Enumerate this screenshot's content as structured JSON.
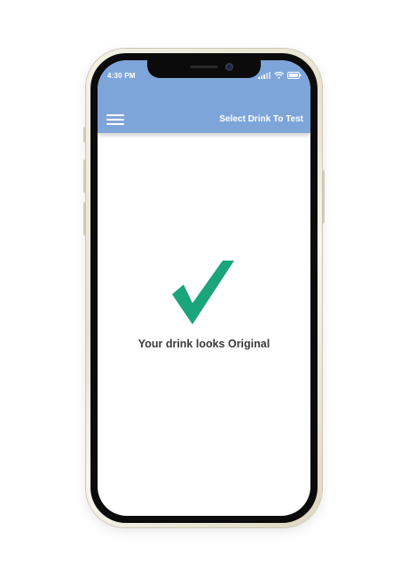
{
  "status_bar": {
    "time": "4:30 PM",
    "icons": [
      "signal-icon",
      "wifi-icon",
      "battery-icon"
    ]
  },
  "header": {
    "menu_icon": "hamburger-menu-icon",
    "title": "Select Drink To Test",
    "background_color": "#7ea5d9"
  },
  "result": {
    "icon": "checkmark-icon",
    "icon_color": "#1aa57a",
    "message": "Your drink looks Original"
  }
}
